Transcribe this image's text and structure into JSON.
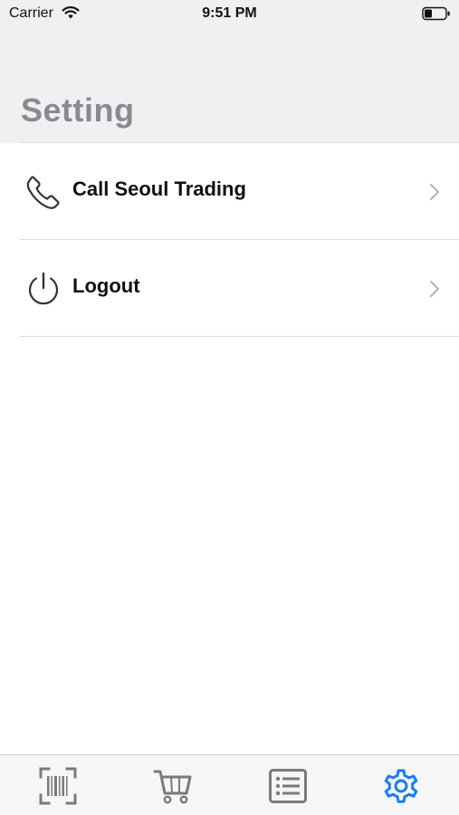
{
  "status_bar": {
    "carrier": "Carrier",
    "time": "9:51 PM",
    "icons": [
      "wifi-icon",
      "battery-icon"
    ]
  },
  "page": {
    "title": "Setting"
  },
  "settings": {
    "items": [
      {
        "label": "Call Seoul Trading",
        "icon": "phone-icon"
      },
      {
        "label": "Logout",
        "icon": "power-icon"
      }
    ]
  },
  "tab_bar": {
    "tabs": [
      {
        "icon": "barcode-scan-icon",
        "active": false
      },
      {
        "icon": "cart-icon",
        "active": false
      },
      {
        "icon": "list-icon",
        "active": false
      },
      {
        "icon": "gear-icon",
        "active": true
      }
    ],
    "colors": {
      "active": "#1a7cf5",
      "inactive": "#7a7a7a"
    }
  }
}
